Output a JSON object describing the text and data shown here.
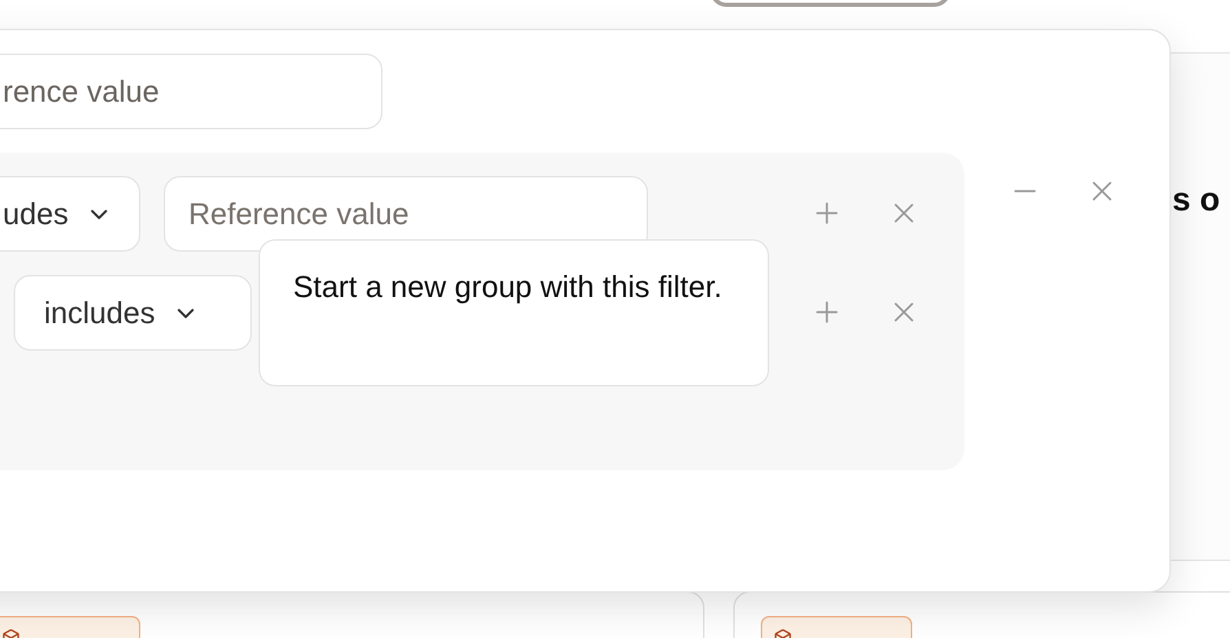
{
  "background": {
    "heading": "s o"
  },
  "filter_panel": {
    "value_field": {
      "placeholder": "rence value"
    },
    "group": {
      "rows": [
        {
          "operator": "udes",
          "value_field": {
            "placeholder": "Reference value"
          }
        },
        {
          "operator": "includes"
        }
      ]
    },
    "tooltip": "Start a new group with this filter."
  }
}
